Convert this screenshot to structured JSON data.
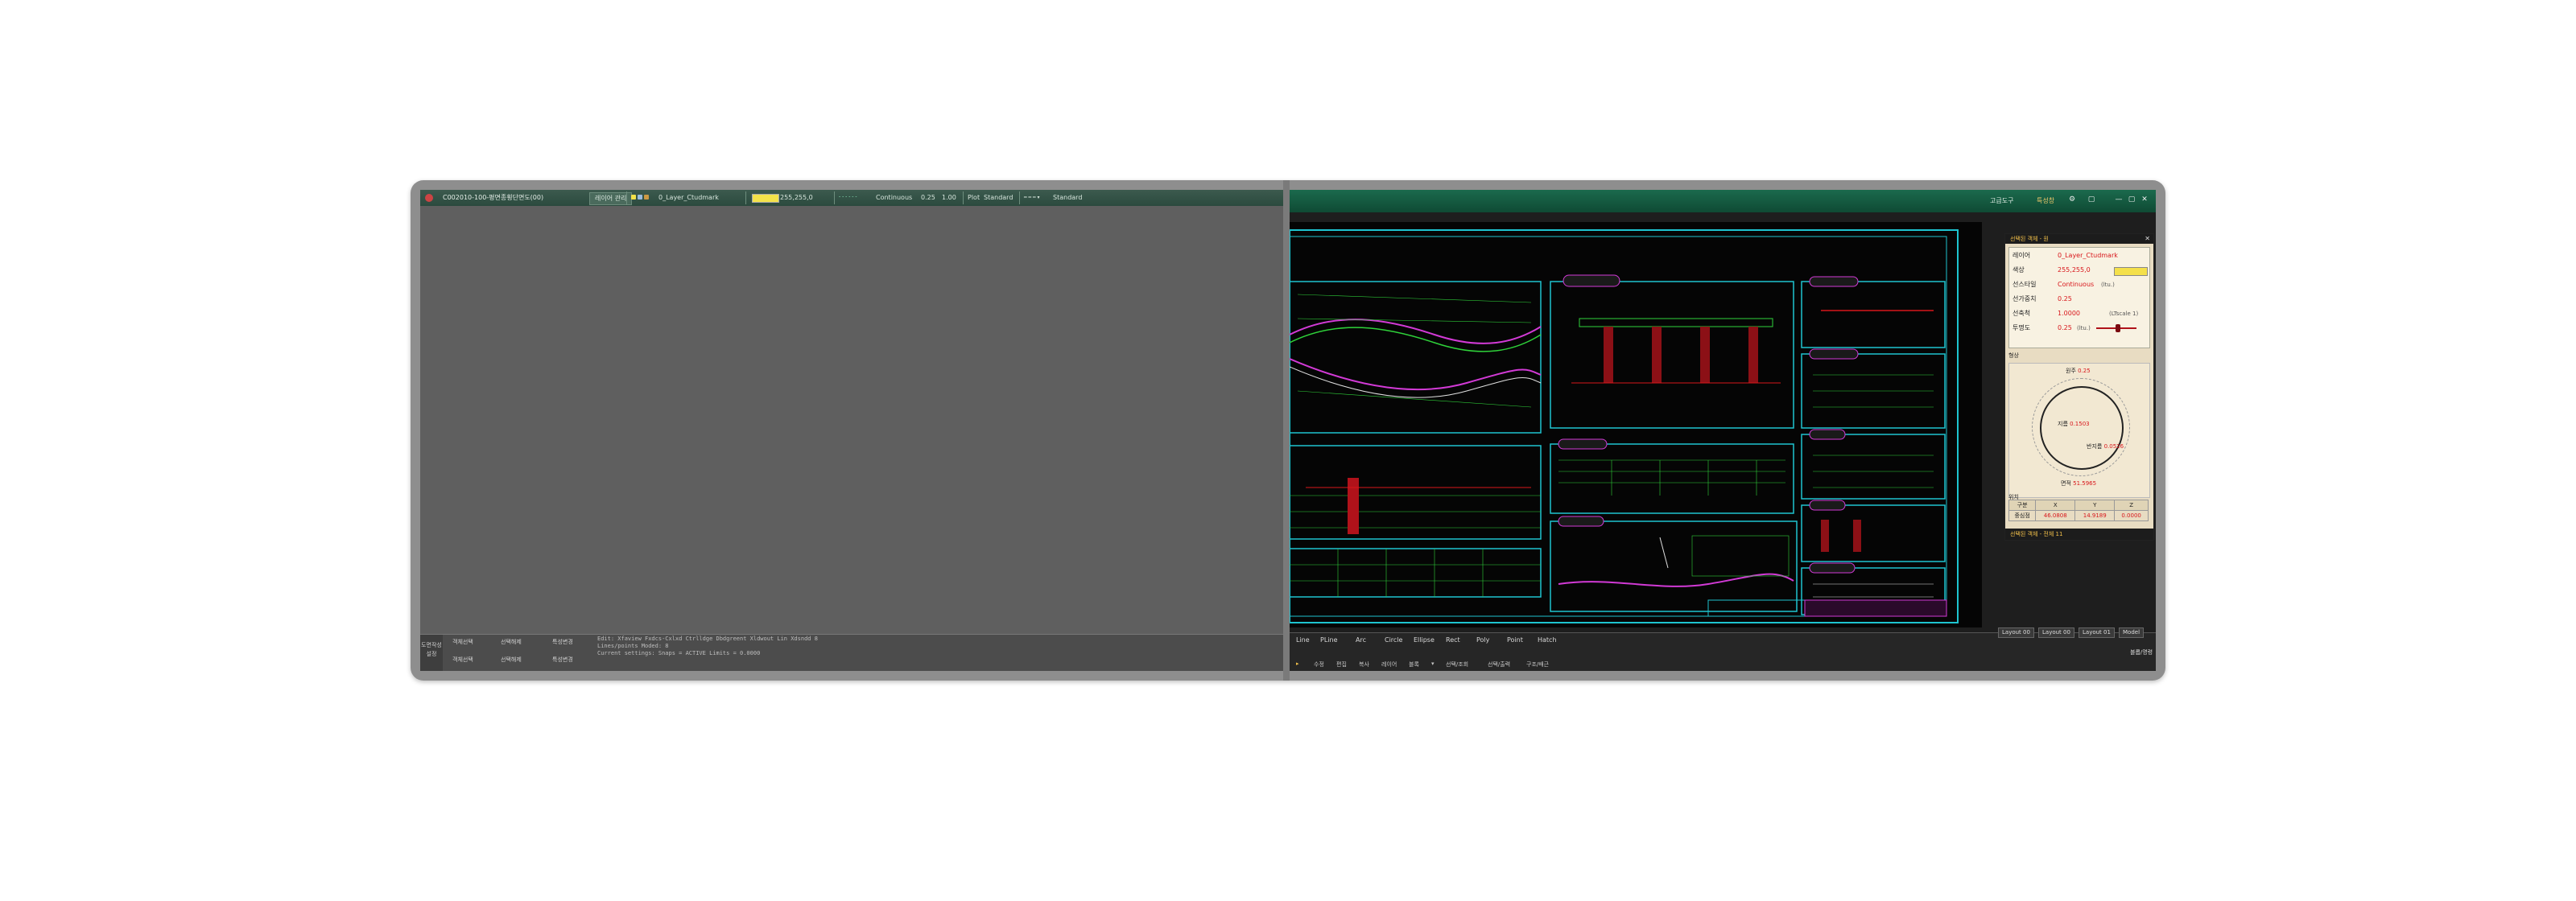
{
  "left_app": {
    "file_title": "C002010-100-평면종횡단면도(00)",
    "tab_label": "레이어 관리",
    "layer_name": "0_Layer_Ctudmark",
    "color_value": "255,255,0",
    "linetype": "Continuous",
    "lineweight": "0.25",
    "lineweight2": "1.00",
    "plot_label": "Plot",
    "plot_style": "Standard",
    "dim_style": "Standard",
    "bottom_side": [
      "도면작성",
      "설정"
    ],
    "bottom_buttons_row1": [
      "객체선택",
      "선택해제",
      "특성변경"
    ],
    "bottom_buttons_row2": [
      "객체선택",
      "선택해제",
      "특성변경"
    ],
    "command_lines": [
      "Edit: Xfaview Fxdcs-Cxlxd Ctrlldge Dbdgreent Xldwout Lin Xdsndd 8",
      "Lines/points Moded: 8",
      "Current settings: Snaps = ACTIVE Limits = 0.0000"
    ]
  },
  "right_app": {
    "title_left": "고급도구",
    "title_highlight": "특성창",
    "window_buttons": [
      "⚙",
      "▢",
      "—",
      "▢",
      "✕"
    ],
    "command_items": [
      "Line",
      "PLine",
      "Arc",
      "Circle",
      "Ellipse",
      "Rect",
      "Poly",
      "Point",
      "Hatch"
    ],
    "command_row2": [
      "수정",
      "편집",
      "복사",
      "레이어",
      "블록",
      "▾",
      "선택/조회",
      "선택/출력",
      "구조/배근"
    ],
    "layout_tabs": [
      "Layout 00",
      "Layout 00",
      "Layout 01",
      "Model"
    ],
    "bottom_right": "블롭/명령"
  },
  "panel": {
    "title": "선택된 객체 - 원",
    "footer": "선택된 객체 - 전체 11",
    "properties": [
      {
        "key": "레이어",
        "value": "0_Layer_Ctudmark"
      },
      {
        "key": "색상",
        "value": "255,255,0"
      },
      {
        "key": "선스타일",
        "value": "Continuous",
        "extra": "(ltu.)"
      },
      {
        "key": "선가중치",
        "value": "0.25"
      },
      {
        "key": "선축척",
        "value": "1.0000",
        "extra": "(LTscale 1)"
      },
      {
        "key": "투명도",
        "value": "0.25",
        "extra": "(ltu.)"
      }
    ],
    "shape_label": "형상",
    "circle": {
      "circumference_label": "원주",
      "circumference": "0.25",
      "diameter_label": "지름",
      "diameter": "0.1503",
      "radius_label": "반지름",
      "radius": "0.0526",
      "area_label": "면적",
      "area": "51.5965"
    },
    "position_label": "위치",
    "table": {
      "headers": [
        "구분",
        "X",
        "Y",
        "Z"
      ],
      "row_label": "중심점",
      "values": [
        "46.0808",
        "14.9189",
        "0.0000"
      ]
    }
  },
  "colors": {
    "accent_green": "#0f4a34",
    "cad_cyan": "#1ec4d0",
    "cad_magenta": "#d23ad6",
    "cad_green": "#2fd23a",
    "cad_red": "#d8161b",
    "panel_bg": "#e8dcc2"
  }
}
